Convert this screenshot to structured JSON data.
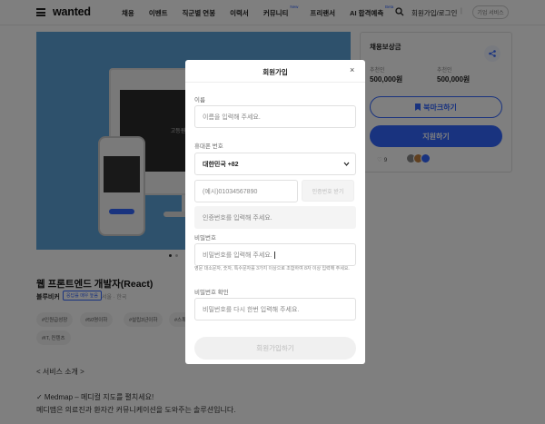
{
  "header": {
    "logo": "wanted",
    "nav": [
      {
        "label": "채용",
        "badge": ""
      },
      {
        "label": "이벤트",
        "badge": ""
      },
      {
        "label": "직군별 연봉",
        "badge": ""
      },
      {
        "label": "이력서",
        "badge": ""
      },
      {
        "label": "커뮤니티",
        "badge": "New"
      },
      {
        "label": "프리랜서",
        "badge": ""
      },
      {
        "label": "AI 합격예측",
        "badge": "Beta"
      }
    ],
    "login": "회원가입/로그인",
    "divider": "|",
    "biz": "기업 서비스"
  },
  "hero": {
    "screen_text": "고등원 20 · 30 · 10명"
  },
  "job": {
    "title": "웹 프론트엔드 개발자(React)",
    "company": "블루비커",
    "response_badge": "응답률 매우 높음",
    "location": "서울 · 한국",
    "tags": [
      "#인원급성장",
      "#50명이하",
      "#설립3년이하",
      "#스톡",
      "#IT, 컨텐츠"
    ],
    "desc_heading": "< 서비스 소개 >",
    "desc_line1": "✓ Medmap – 메디컬 지도를 펼치세요!",
    "desc_line2": "메디맵은 의료진과 환자간 커뮤니케이션을 도와주는 솔루션입니다."
  },
  "side": {
    "title": "채용보상금",
    "referrer_label": "추천인",
    "referrer_value": "500,000원",
    "applicant_label": "추천인",
    "applicant_value": "500,000원",
    "bookmark": "북마크하기",
    "apply": "지원하기",
    "likes": "9"
  },
  "modal": {
    "title": "회원가입",
    "close": "×",
    "name_label": "이름",
    "name_placeholder": "이름을 입력해 주세요.",
    "phone_label": "휴대폰 번호",
    "country": "대한민국 +82",
    "phone_placeholder": "(예시)01034567890",
    "verify_button": "인증번호 받기",
    "code_placeholder": "인증번호를 입력해 주세요.",
    "password_label": "비밀번호",
    "password_placeholder": "비밀번호를 입력해 주세요.",
    "password_hint": "영문 대소문자, 숫자, 특수문자를 3가지 이상으로 조합하여 8자 이상 입력해 주세요.",
    "confirm_label": "비밀번호 확인",
    "confirm_placeholder": "비밀번호를 다시 한번 입력해 주세요.",
    "submit": "회원가입하기"
  },
  "colors": {
    "accent": "#3366ff",
    "hero_bg": "#5da3d8",
    "overlay": "rgba(0,0,0,0.5)"
  }
}
